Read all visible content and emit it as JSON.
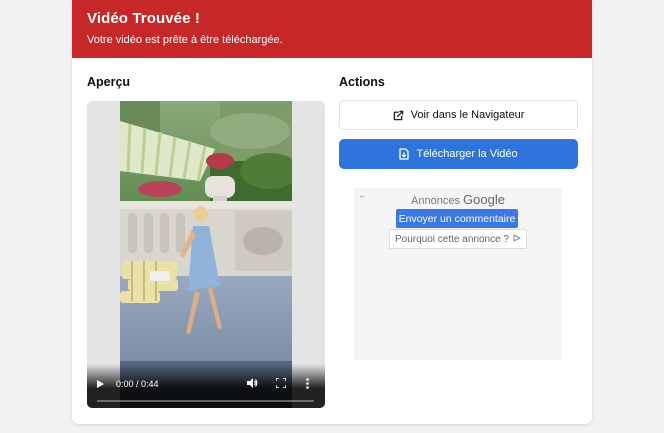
{
  "banner": {
    "title": "Vidéo Trouvée !",
    "subtitle": "Votre vidéo est prête à être téléchargée."
  },
  "preview": {
    "heading": "Aperçu",
    "player": {
      "time": "0:00 / 0:44",
      "progress": 0.0,
      "controls": [
        "play-icon",
        "volume-icon",
        "fullscreen-icon",
        "more-options-icon"
      ]
    }
  },
  "actions": {
    "heading": "Actions",
    "open_browser_label": "Voir dans le Navigateur",
    "download_label": "Télécharger la Vidéo",
    "colors": {
      "primary": "#2f74dc",
      "banner": "#c62828"
    }
  },
  "ad": {
    "label_prefix": "Annonces",
    "label_brand": "Google",
    "feedback_label": "Envoyer un commentaire",
    "why_label": "Pourquoi cette annonce ?"
  }
}
